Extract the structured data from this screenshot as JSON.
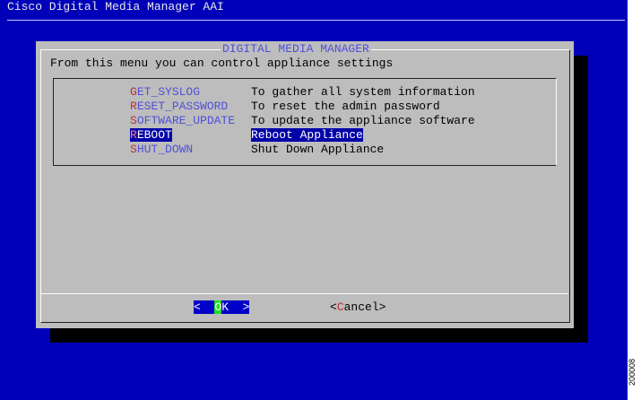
{
  "window": {
    "title": "Cisco Digital Media Manager AAI"
  },
  "figure_id": "200008",
  "dialog": {
    "title": "DIGITAL MEDIA MANAGER",
    "prompt": "From this menu you can control appliance settings",
    "selected_index": 3,
    "items": [
      {
        "hotkey": "G",
        "rest": "ET_SYSLOG",
        "description": "To gather all system information"
      },
      {
        "hotkey": "R",
        "rest": "ESET_PASSWORD",
        "description": "To reset the admin password"
      },
      {
        "hotkey": "S",
        "rest": "OFTWARE_UPDATE",
        "description": "To update the appliance software"
      },
      {
        "hotkey": "R",
        "rest": "EBOOT",
        "description": "Reboot Appliance"
      },
      {
        "hotkey": "S",
        "rest": "HUT_DOWN",
        "description": "Shut Down Appliance"
      }
    ],
    "ok": {
      "pre": "<  ",
      "hotkey": "O",
      "rest": "K  >"
    },
    "cancel": {
      "pre": "<",
      "hotkey": "C",
      "rest": "ancel>"
    }
  },
  "colors": {
    "background": "#0000b8",
    "dialog": "#bdbdbd",
    "hotkey": "#c03030",
    "tag": "#5050d8",
    "ok_focus": "#20e020"
  }
}
